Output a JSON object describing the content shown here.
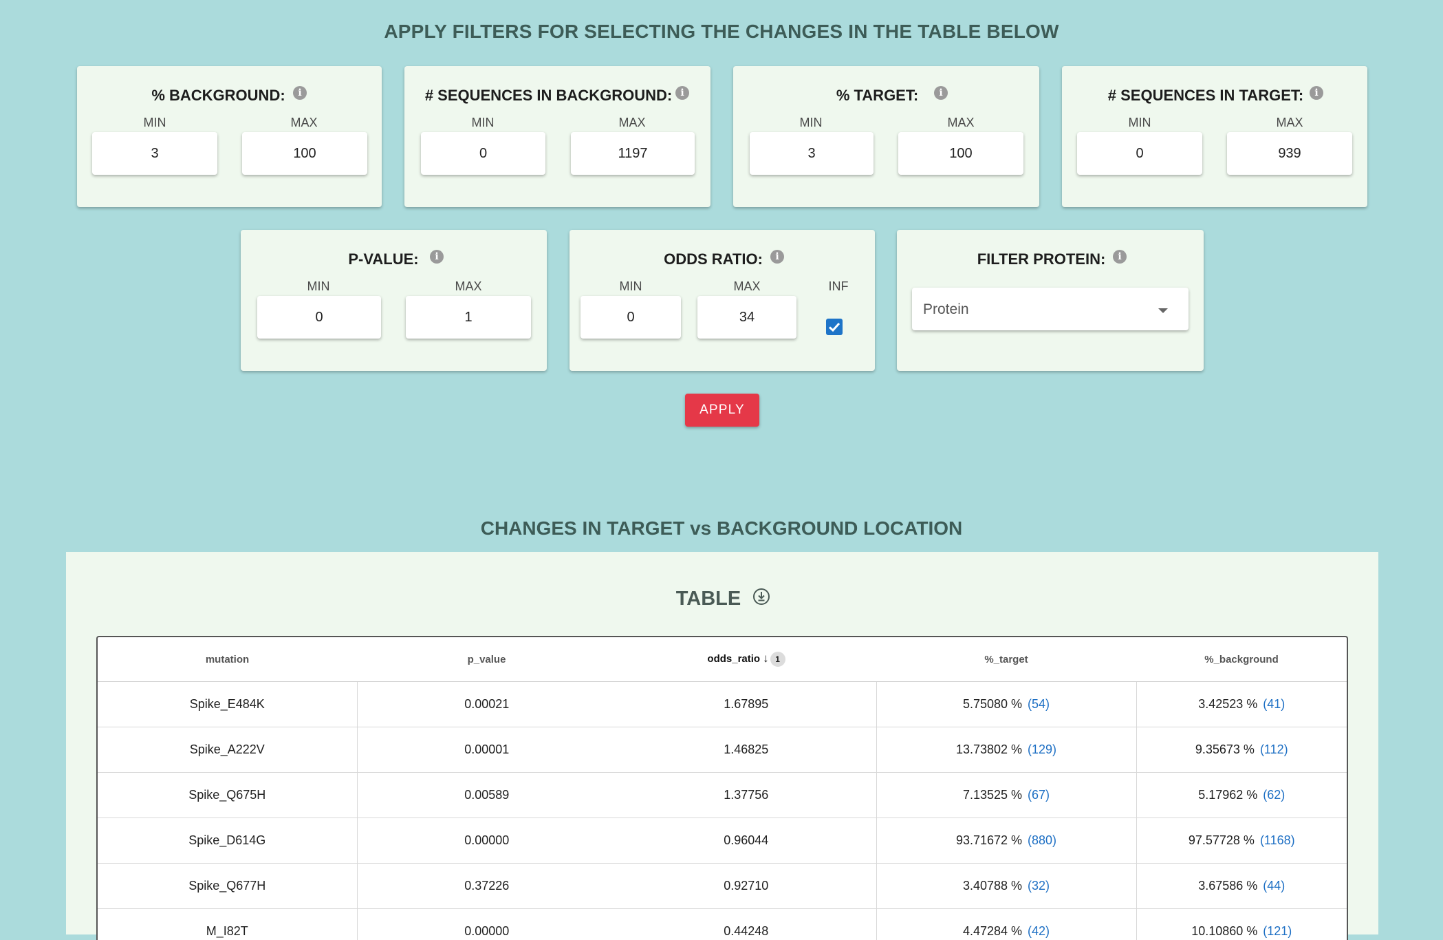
{
  "page": {
    "filters_title": "APPLY FILTERS FOR SELECTING THE CHANGES IN THE TABLE BELOW",
    "table_section_title": "CHANGES IN TARGET vs BACKGROUND LOCATION"
  },
  "labels": {
    "min": "MIN",
    "max": "MAX",
    "inf": "INF"
  },
  "filters": {
    "pct_background": {
      "title": "% BACKGROUND:",
      "min": "3",
      "max": "100"
    },
    "seq_background": {
      "title": "# SEQUENCES IN BACKGROUND:",
      "min": "0",
      "max": "1197"
    },
    "pct_target": {
      "title": "% TARGET:",
      "min": "3",
      "max": "100"
    },
    "seq_target": {
      "title": "# SEQUENCES IN TARGET:",
      "min": "0",
      "max": "939"
    },
    "p_value": {
      "title": "P-VALUE:",
      "min": "0",
      "max": "1"
    },
    "odds_ratio": {
      "title": "ODDS RATIO:",
      "min": "0",
      "max": "34",
      "inf_checked": true
    },
    "protein": {
      "title": "FILTER PROTEIN:",
      "selected": "Protein"
    }
  },
  "apply_label": "APPLY",
  "table": {
    "heading": "TABLE",
    "columns": [
      "mutation",
      "p_value",
      "odds_ratio",
      "%_target",
      "%_background"
    ],
    "sort_badge": "1",
    "rows": [
      {
        "mutation": "Spike_E484K",
        "p_value": "0.00021",
        "odds_ratio": "1.67895",
        "target_pct": "5.75080 %",
        "target_cnt": "(54)",
        "bg_pct": "3.42523 %",
        "bg_cnt": "(41)"
      },
      {
        "mutation": "Spike_A222V",
        "p_value": "0.00001",
        "odds_ratio": "1.46825",
        "target_pct": "13.73802 %",
        "target_cnt": "(129)",
        "bg_pct": "9.35673 %",
        "bg_cnt": "(112)"
      },
      {
        "mutation": "Spike_Q675H",
        "p_value": "0.00589",
        "odds_ratio": "1.37756",
        "target_pct": "7.13525 %",
        "target_cnt": "(67)",
        "bg_pct": "5.17962 %",
        "bg_cnt": "(62)"
      },
      {
        "mutation": "Spike_D614G",
        "p_value": "0.00000",
        "odds_ratio": "0.96044",
        "target_pct": "93.71672 %",
        "target_cnt": "(880)",
        "bg_pct": "97.57728 %",
        "bg_cnt": "(1168)"
      },
      {
        "mutation": "Spike_Q677H",
        "p_value": "0.37226",
        "odds_ratio": "0.92710",
        "target_pct": "3.40788 %",
        "target_cnt": "(32)",
        "bg_pct": "3.67586 %",
        "bg_cnt": "(44)"
      },
      {
        "mutation": "M_I82T",
        "p_value": "0.00000",
        "odds_ratio": "0.44248",
        "target_pct": "4.47284 %",
        "target_cnt": "(42)",
        "bg_pct": "10.10860 %",
        "bg_cnt": "(121)"
      }
    ]
  },
  "colors": {
    "background": "#abdbdc",
    "card": "#eff8ee",
    "apply": "#e53848",
    "link": "#1d6fc4",
    "checkbox": "#1e74c8"
  }
}
